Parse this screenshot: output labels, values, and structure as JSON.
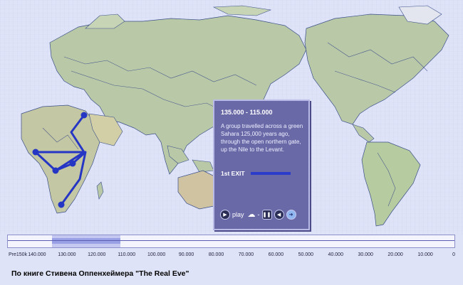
{
  "panel": {
    "title": "135.000 - 115.000",
    "text": "A group travelled across a green Sahara 125,000 years ago, through the open northern gate, up the Nile to the Levant.",
    "exit_label": "1st EXIT",
    "play_label": "play"
  },
  "timeline": {
    "ticks": [
      "Pre150k",
      "140.000",
      "130.000",
      "120.000",
      "110.000",
      "100.000",
      "90.000",
      "80.000",
      "70.000",
      "60.000",
      "50.000",
      "40.000",
      "30.000",
      "20.000",
      "10.000",
      "0"
    ],
    "selected_range": [
      "135.000",
      "115.000"
    ]
  },
  "caption": "По книге Стивена Оппенхеймера \"The Real Eve\"",
  "colors": {
    "ocean": "#dfe3f7",
    "land": "#b9c9a8",
    "route": "#2636c4",
    "panel": "#6a69a8"
  },
  "icons": [
    "play-icon",
    "cloud-icon",
    "pause-icon",
    "rewind-icon",
    "forward-icon"
  ]
}
